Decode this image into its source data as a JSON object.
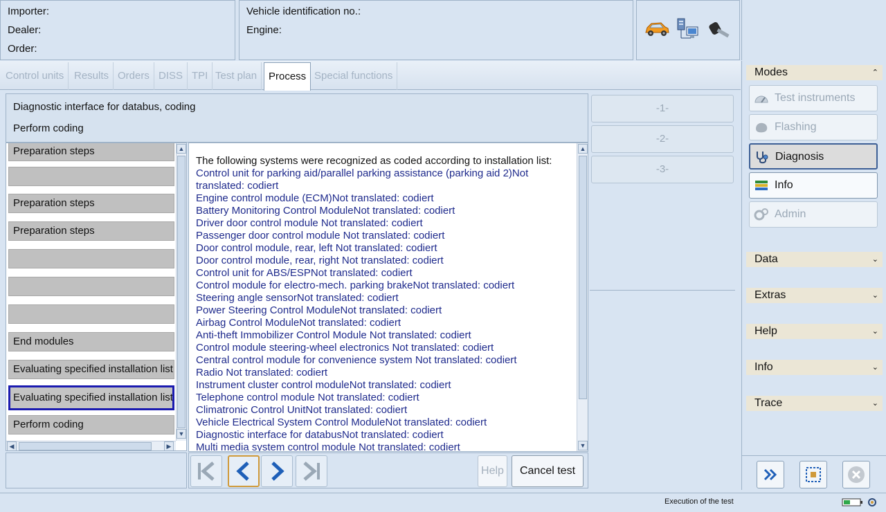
{
  "header": {
    "importer_label": "Importer:",
    "dealer_label": "Dealer:",
    "order_label": "Order:",
    "vin_label": "Vehicle identification no.:",
    "engine_label": "Engine:"
  },
  "tabs": [
    {
      "label": "Control units"
    },
    {
      "label": "Results"
    },
    {
      "label": "Orders"
    },
    {
      "label": "DISS"
    },
    {
      "label": "TPI"
    },
    {
      "label": "Test plan"
    },
    {
      "label": "Process"
    },
    {
      "label": "Special functions"
    }
  ],
  "title": {
    "line1": "Diagnostic interface for databus, coding",
    "line2": "Perform coding"
  },
  "steps": [
    {
      "label": "Preparation steps"
    },
    {
      "label": ""
    },
    {
      "label": "Preparation steps"
    },
    {
      "label": "Preparation steps"
    },
    {
      "label": ""
    },
    {
      "label": ""
    },
    {
      "label": ""
    },
    {
      "label": "End modules"
    },
    {
      "label": "Evaluating specified installation list"
    },
    {
      "label": "Evaluating specified installation list"
    },
    {
      "label": "Perform coding"
    }
  ],
  "content": {
    "intro": "The following systems were recognized as coded according to installation list:",
    "systems": [
      "Control unit for parking aid/parallel parking assistance (parking aid 2)Not translated: codiert",
      "Engine control module (ECM)Not translated: codiert",
      "Battery Monitoring Control ModuleNot translated: codiert",
      "Driver door control module Not translated: codiert",
      "Passenger door control module Not translated: codiert",
      "Door control module, rear, left Not translated: codiert",
      "Door control module, rear, right Not translated: codiert",
      "Control unit for ABS/ESPNot translated: codiert",
      "Control module for electro-mech. parking brakeNot translated: codiert",
      "Steering angle sensorNot translated: codiert",
      "Power Steering Control ModuleNot translated: codiert",
      "Airbag Control ModuleNot translated: codiert",
      "Anti-theft Immobilizer Control Module Not translated: codiert",
      "Control module steering-wheel electronics Not translated: codiert",
      "Central control module for convenience system Not translated: codiert",
      "Radio Not translated: codiert",
      "Instrument cluster control moduleNot translated: codiert",
      "Telephone control module Not translated: codiert",
      "Climatronic Control UnitNot translated: codiert",
      "Vehicle Electrical System Control ModuleNot translated: codiert",
      "Diagnostic interface for databusNot translated: codiert",
      "Multi media system control module Not translated: codiert"
    ]
  },
  "nav": {
    "help_label": "Help",
    "cancel_label": "Cancel test"
  },
  "numbered_buttons": [
    "-1-",
    "-2-",
    "-3-"
  ],
  "side": {
    "modes_title": "Modes",
    "modes": [
      {
        "label": "Test instruments",
        "icon": "gauge-icon"
      },
      {
        "label": "Flashing",
        "icon": "flash-icon"
      },
      {
        "label": "Diagnosis",
        "icon": "stethoscope-icon"
      },
      {
        "label": "Info",
        "icon": "books-icon"
      },
      {
        "label": "Admin",
        "icon": "gears-icon"
      }
    ],
    "sections": [
      "Data",
      "Extras",
      "Help",
      "Info",
      "Trace"
    ]
  },
  "status": {
    "text": "Execution of the test"
  },
  "colors": {
    "background": "#d8e4f2",
    "system_text": "#1e2a8c",
    "selected_border": "#1b1bb0",
    "section_header": "#ebe6d6"
  }
}
